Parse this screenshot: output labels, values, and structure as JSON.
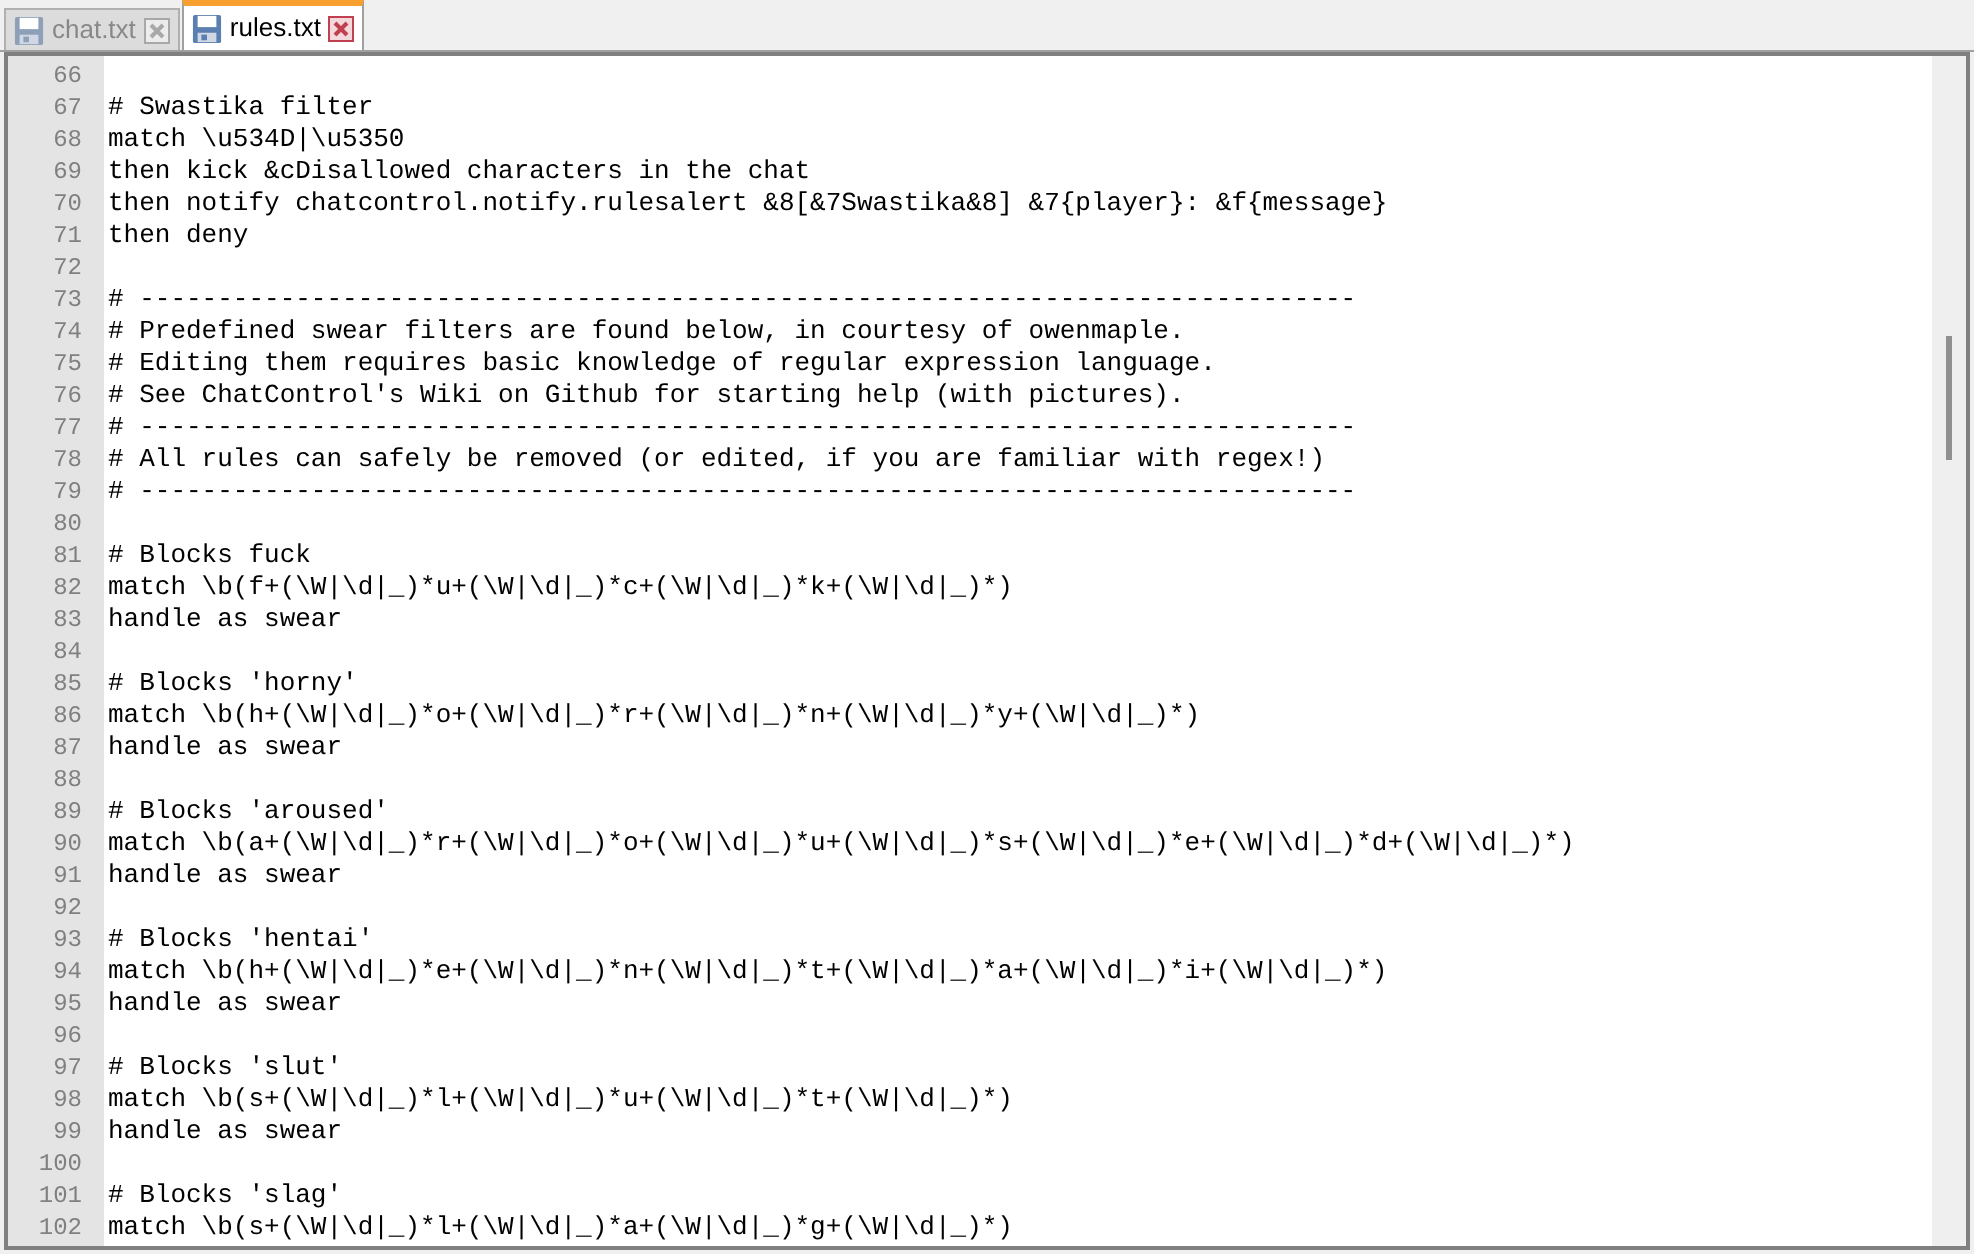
{
  "tabs": [
    {
      "label": "chat.txt",
      "selected": false
    },
    {
      "label": "rules.txt",
      "selected": true
    }
  ],
  "editor": {
    "lines": [
      {
        "number": "66"
      },
      {
        "number": "67",
        "text": "# Swastika filter"
      },
      {
        "number": "68",
        "text": "match \\u534D|\\u5350"
      },
      {
        "number": "69",
        "text": "then kick &cDisallowed characters in the chat"
      },
      {
        "number": "70",
        "text": "then notify chatcontrol.notify.rulesalert &8[&7Swastika&8] &7{player}: &f{message}"
      },
      {
        "number": "71",
        "text": "then deny"
      },
      {
        "number": "72"
      },
      {
        "number": "73",
        "text": "# ------------------------------------------------------------------------------"
      },
      {
        "number": "74",
        "text": "# Predefined swear filters are found below, in courtesy of owenmaple."
      },
      {
        "number": "75",
        "text": "# Editing them requires basic knowledge of regular expression language."
      },
      {
        "number": "76",
        "text": "# See ChatControl's Wiki on Github for starting help (with pictures)."
      },
      {
        "number": "77",
        "text": "# ------------------------------------------------------------------------------"
      },
      {
        "number": "78",
        "text": "# All rules can safely be removed (or edited, if you are familiar with regex!)"
      },
      {
        "number": "79",
        "text": "# ------------------------------------------------------------------------------"
      },
      {
        "number": "80"
      },
      {
        "number": "81",
        "text": "# Blocks fuck"
      },
      {
        "number": "82",
        "text": "match \\b(f+(\\W|\\d|_)*u+(\\W|\\d|_)*c+(\\W|\\d|_)*k+(\\W|\\d|_)*)"
      },
      {
        "number": "83",
        "text": "handle as swear"
      },
      {
        "number": "84"
      },
      {
        "number": "85",
        "text": "# Blocks 'horny'"
      },
      {
        "number": "86",
        "text": "match \\b(h+(\\W|\\d|_)*o+(\\W|\\d|_)*r+(\\W|\\d|_)*n+(\\W|\\d|_)*y+(\\W|\\d|_)*)"
      },
      {
        "number": "87",
        "text": "handle as swear"
      },
      {
        "number": "88"
      },
      {
        "number": "89",
        "text": "# Blocks 'aroused'"
      },
      {
        "number": "90",
        "text": "match \\b(a+(\\W|\\d|_)*r+(\\W|\\d|_)*o+(\\W|\\d|_)*u+(\\W|\\d|_)*s+(\\W|\\d|_)*e+(\\W|\\d|_)*d+(\\W|\\d|_)*)"
      },
      {
        "number": "91",
        "text": "handle as swear"
      },
      {
        "number": "92"
      },
      {
        "number": "93",
        "text": "# Blocks 'hentai'"
      },
      {
        "number": "94",
        "text": "match \\b(h+(\\W|\\d|_)*e+(\\W|\\d|_)*n+(\\W|\\d|_)*t+(\\W|\\d|_)*a+(\\W|\\d|_)*i+(\\W|\\d|_)*)"
      },
      {
        "number": "95",
        "text": "handle as swear"
      },
      {
        "number": "96"
      },
      {
        "number": "97",
        "text": "# Blocks 'slut'"
      },
      {
        "number": "98",
        "text": "match \\b(s+(\\W|\\d|_)*l+(\\W|\\d|_)*u+(\\W|\\d|_)*t+(\\W|\\d|_)*)"
      },
      {
        "number": "99",
        "text": "handle as swear"
      },
      {
        "number": "100"
      },
      {
        "number": "101",
        "text": "# Blocks 'slag'"
      },
      {
        "number": "102",
        "text": "match \\b(s+(\\W|\\d|_)*l+(\\W|\\d|_)*a+(\\W|\\d|_)*g+(\\W|\\d|_)*)"
      }
    ]
  }
}
